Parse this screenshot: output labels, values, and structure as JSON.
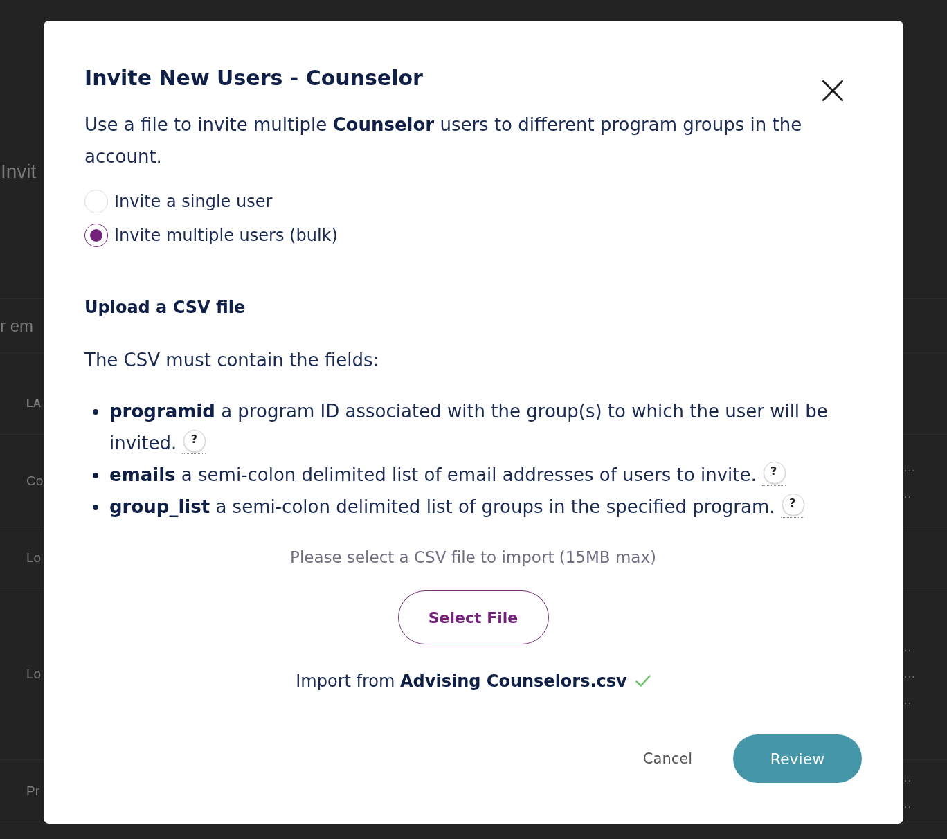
{
  "background_page": {
    "title": "Invit",
    "search_text": "r em",
    "table": {
      "header": "LA",
      "rows": [
        {
          "cell": "Co",
          "trailing": [
            "...",
            ".."
          ]
        },
        {
          "cell": "Lo"
        },
        {
          "cell": "Lo",
          "trailing": [
            "..",
            "...",
            ".."
          ]
        },
        {
          "cell": "Pr",
          "trailing": [
            "..",
            ".."
          ]
        }
      ]
    }
  },
  "dialog": {
    "title": "Invite New Users - Counselor",
    "description": "Use a file to invite multiple **Counselor** users to different program groups in the account.",
    "options": [
      {
        "label": "Invite a single user",
        "selected": false
      },
      {
        "label": "Invite multiple users (bulk)",
        "selected": true
      }
    ],
    "upload": {
      "heading": "Upload a CSV file",
      "intro": "The CSV must contain the fields:",
      "fields": [
        {
          "text": "**programid** a program ID associated with the group(s) to which the user will be invited.",
          "help": "?"
        },
        {
          "text": "**emails** a semi-colon delimited list of email addresses of users to invite.",
          "help": "?"
        },
        {
          "text": "**group_list** a semi-colon delimited list of groups in the specified program.",
          "help": "?"
        }
      ],
      "hint": "Please select a CSV file to import (15MB max)",
      "select_button": "Select File",
      "import_status": "Import from **Advising Counselors.csv**"
    },
    "buttons": [
      {
        "label": "Cancel",
        "kind": "text"
      },
      {
        "label": "Review",
        "kind": "primary"
      }
    ]
  }
}
